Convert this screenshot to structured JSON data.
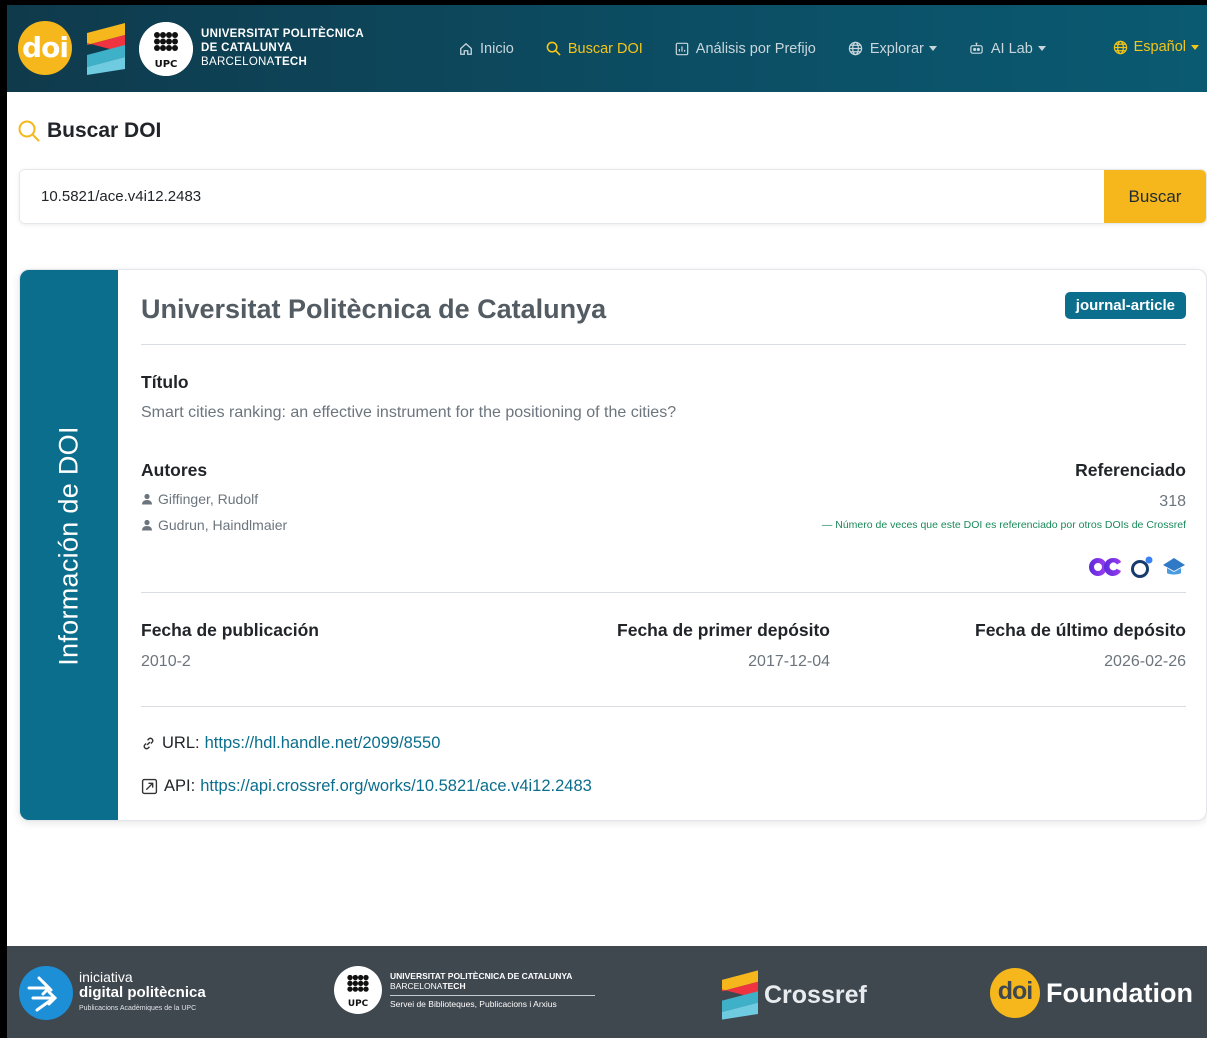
{
  "nav": {
    "logo_doi": "doi",
    "upc_line1": "UNIVERSITAT POLITÈCNICA",
    "upc_line2": "DE CATALUNYA",
    "upc_line3_a": "BARCELONA",
    "upc_line3_b": "TECH",
    "upc_mark": "UPC",
    "items": [
      {
        "label": "Inicio",
        "icon": "home-icon"
      },
      {
        "label": "Buscar DOI",
        "icon": "search-icon",
        "active": true
      },
      {
        "label": "Análisis por Prefijo",
        "icon": "chart-icon"
      },
      {
        "label": "Explorar",
        "icon": "globe-icon",
        "dropdown": true
      },
      {
        "label": "AI Lab",
        "icon": "robot-icon",
        "dropdown": true
      }
    ],
    "language": "Español"
  },
  "page": {
    "title": "Buscar DOI"
  },
  "search": {
    "value": "10.5821/ace.v4i12.2483",
    "button_label": "Buscar"
  },
  "card": {
    "side_label": "Información de DOI",
    "publisher": "Universitat Politècnica de Catalunya",
    "type_badge": "journal-article",
    "title_label": "Título",
    "title_value": "Smart cities ranking: an effective instrument for the positioning of the cities?",
    "authors_label": "Autores",
    "authors": [
      "Giffinger, Rudolf",
      "Gudrun, Haindlmaier"
    ],
    "referenced_label": "Referenciado",
    "referenced_value": "318",
    "referenced_note": "— Número de veces que este DOI es referenciado por otros DOIs de Crossref",
    "pub_date_label": "Fecha de publicación",
    "pub_date_value": "2010-2",
    "first_deposit_label": "Fecha de primer depósito",
    "first_deposit_value": "2017-12-04",
    "last_deposit_label": "Fecha de último depósito",
    "last_deposit_value": "2026-02-26",
    "url_label": "URL:",
    "url_value": "https://hdl.handle.net/2099/8550",
    "api_label": "API:",
    "api_value": "https://api.crossref.org/works/10.5821/ace.v4i12.2483"
  },
  "footer": {
    "idp_line1": "iniciativa",
    "idp_line2": "digital politècnica",
    "idp_line3": "Publicacions Acadèmiques de la UPC",
    "upc_line1": "UNIVERSITAT POLITÈCNICA DE CATALUNYA",
    "upc_line2_a": "BARCELONA",
    "upc_line2_b": "TECH",
    "upc_line3": "Servei de Biblioteques, Publicacions i Arxius",
    "upc_mark": "UPC",
    "crossref": "Crossref",
    "doi_mark": "doi",
    "foundation": "Foundation"
  },
  "colors": {
    "nav_bg": "#0c4d63",
    "accent_yellow": "#f5b71b",
    "card_side": "#0a6e8c",
    "footer_bg": "#3f474f"
  }
}
